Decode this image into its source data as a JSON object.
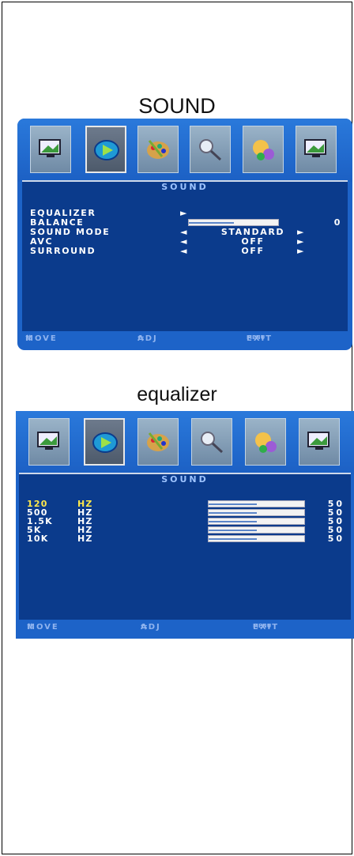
{
  "captions": {
    "sound": "SOUND",
    "equalizer": "equalizer"
  },
  "colors": {
    "osd_background": "#1d63c8",
    "panel": "#0b3b8c",
    "highlight": "#ffe84a",
    "footer_text": "#8fb3ee"
  },
  "icons": [
    "picture-icon",
    "sound-icon",
    "palette-icon",
    "magnifier-icon",
    "user-settings-icon",
    "monitor-icon"
  ],
  "sound_menu": {
    "header": "SOUND",
    "selected_tab": "sound-icon",
    "items": [
      {
        "label": "EQUALIZER",
        "value": ""
      },
      {
        "label": "BALANCE",
        "value": "0",
        "bar_fraction": 0.5
      },
      {
        "label": "SOUND MODE",
        "value": "STANDARD"
      },
      {
        "label": "AVC",
        "value": "OFF"
      },
      {
        "label": "SURROUND",
        "value": "OFF"
      }
    ],
    "arrow_left": "◄",
    "arrow_right": "►",
    "footer": {
      "move_glyph": "⇅",
      "move": "MOVE",
      "adj_glyph": "⇆",
      "adj": "ADJ",
      "menu": "MENU",
      "exit": "EXIT"
    }
  },
  "equalizer_menu": {
    "header": "SOUND",
    "bands": [
      {
        "freq": "120",
        "unit": "HZ",
        "value": "50",
        "level": 0.5,
        "active": true
      },
      {
        "freq": "500",
        "unit": "HZ",
        "value": "50",
        "level": 0.5
      },
      {
        "freq": "1.5K",
        "unit": "HZ",
        "value": "50",
        "level": 0.5
      },
      {
        "freq": "5K",
        "unit": "HZ",
        "value": "50",
        "level": 0.5
      },
      {
        "freq": "10K",
        "unit": "HZ",
        "value": "50",
        "level": 0.5
      }
    ],
    "footer": {
      "move_glyph": "⇅",
      "move": "MOVE",
      "adj_glyph": "⇆",
      "adj": "ADJ",
      "menu": "MENU",
      "exit": "EXIT"
    }
  }
}
